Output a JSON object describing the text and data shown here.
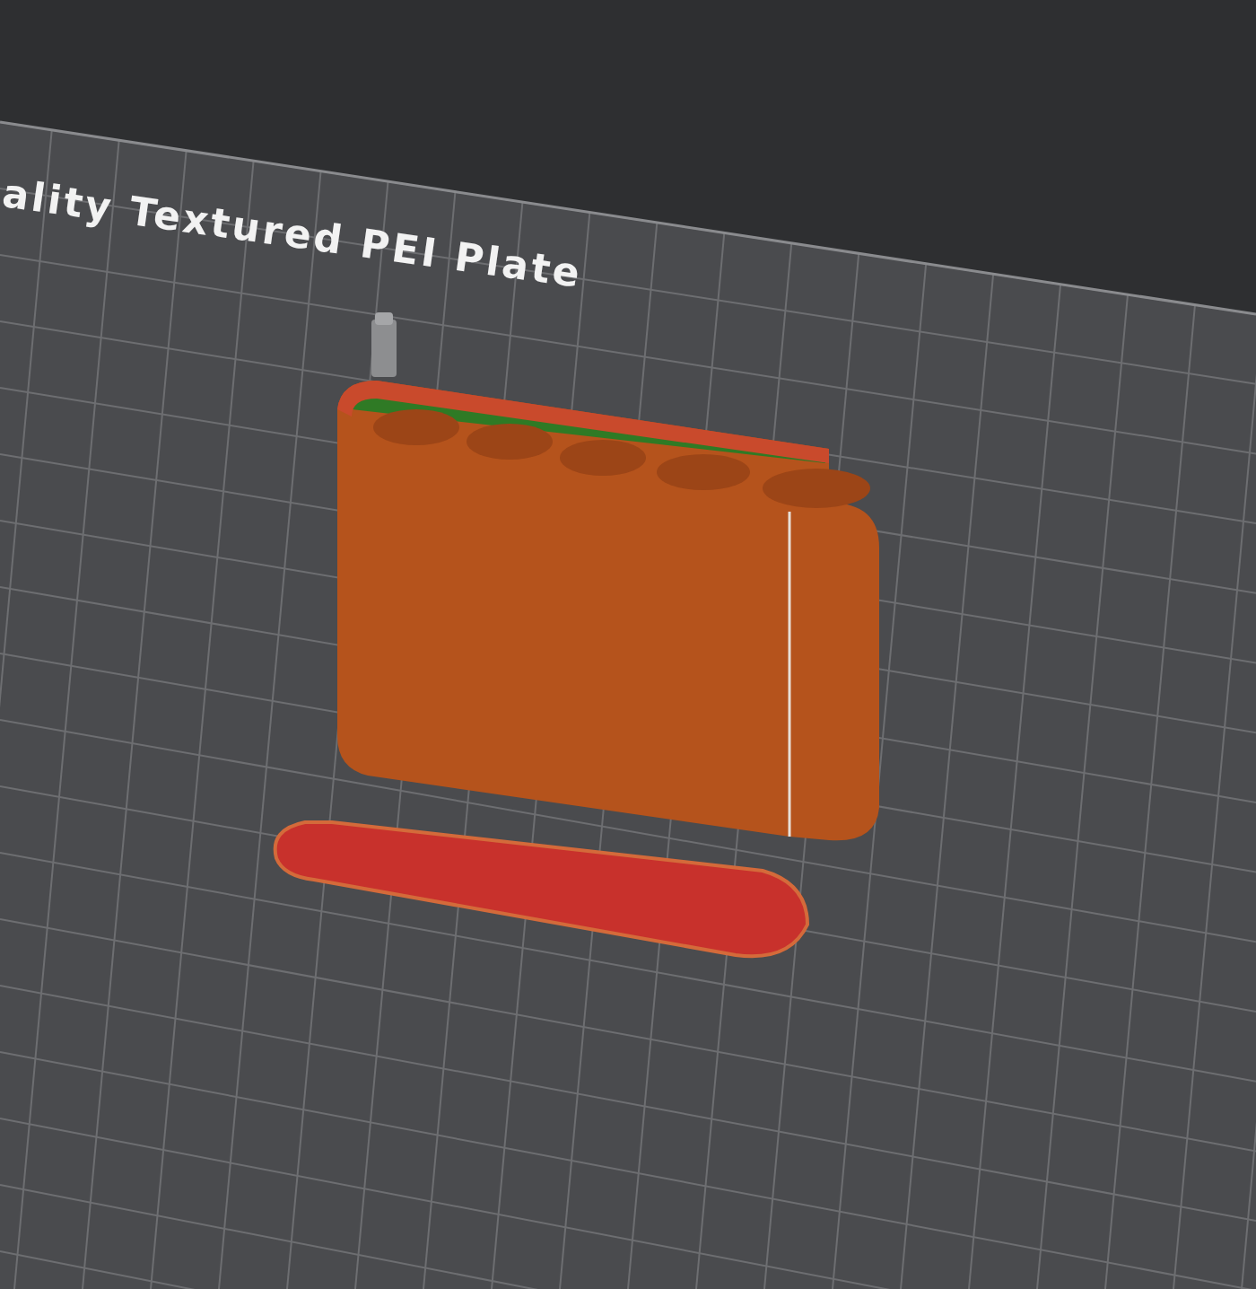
{
  "viewport": {
    "plate_label": "ality Textured PEI Plate"
  }
}
